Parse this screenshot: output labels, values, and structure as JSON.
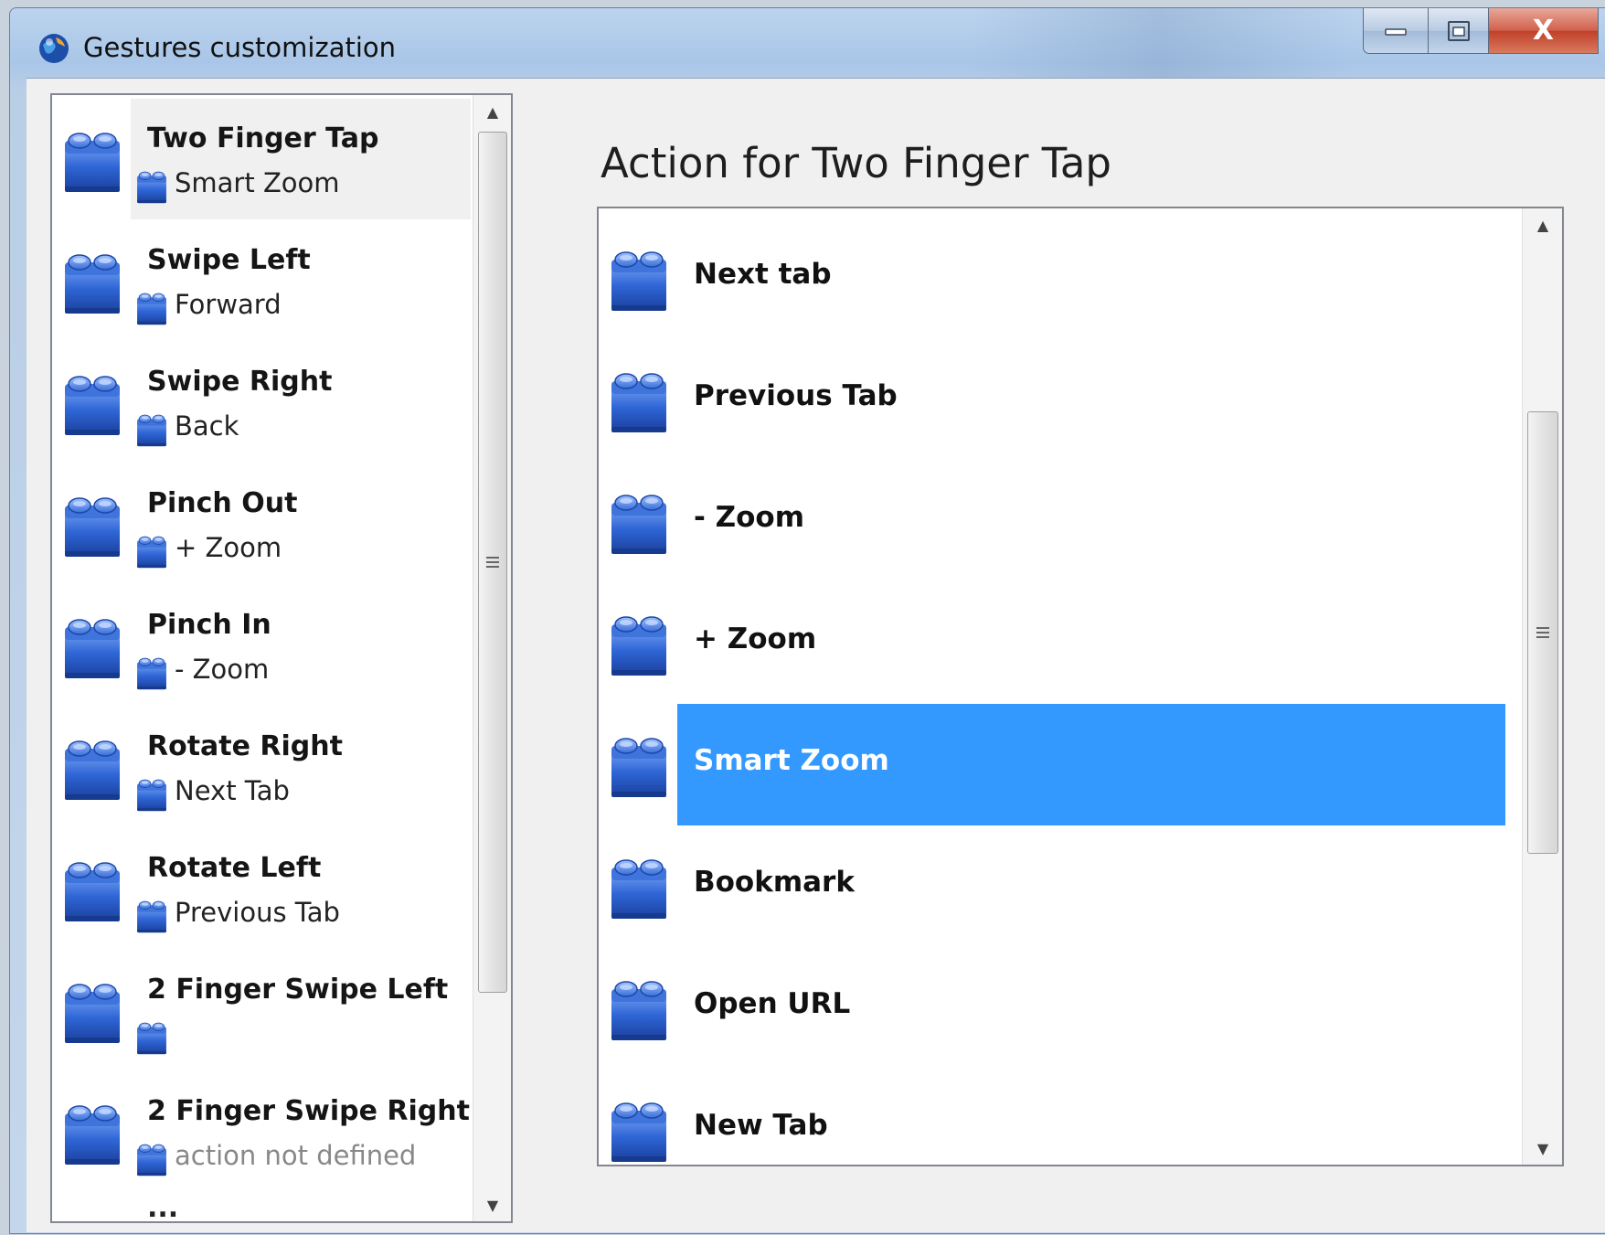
{
  "window": {
    "title": "Gestures customization",
    "app_icon": "globe-icon",
    "controls": {
      "minimize_icon": "minimize-icon",
      "maximize_icon": "maximize-icon",
      "close_label": "X"
    }
  },
  "gestures": {
    "items": [
      {
        "name": "Two Finger Tap",
        "action": "Smart Zoom",
        "selected": true
      },
      {
        "name": "Swipe Left",
        "action": "Forward"
      },
      {
        "name": "Swipe Right",
        "action": "Back"
      },
      {
        "name": "Pinch Out",
        "action": "+ Zoom"
      },
      {
        "name": "Pinch In",
        "action": "- Zoom"
      },
      {
        "name": "Rotate Right",
        "action": "Next Tab"
      },
      {
        "name": "Rotate Left",
        "action": "Previous Tab"
      },
      {
        "name": "2 Finger Swipe Left",
        "action": ""
      },
      {
        "name": "2 Finger Swipe Right",
        "action": "action not defined"
      }
    ],
    "more": "..."
  },
  "action_panel": {
    "heading": "Action for Two Finger Tap",
    "items": [
      {
        "label": "Next tab"
      },
      {
        "label": "Previous Tab"
      },
      {
        "label": "- Zoom"
      },
      {
        "label": "+ Zoom"
      },
      {
        "label": "Smart Zoom",
        "selected": true
      },
      {
        "label": "Bookmark"
      },
      {
        "label": "Open URL"
      },
      {
        "label": "New Tab"
      }
    ]
  },
  "colors": {
    "selection": "#3399ff",
    "brick": "#2a5fc8"
  }
}
